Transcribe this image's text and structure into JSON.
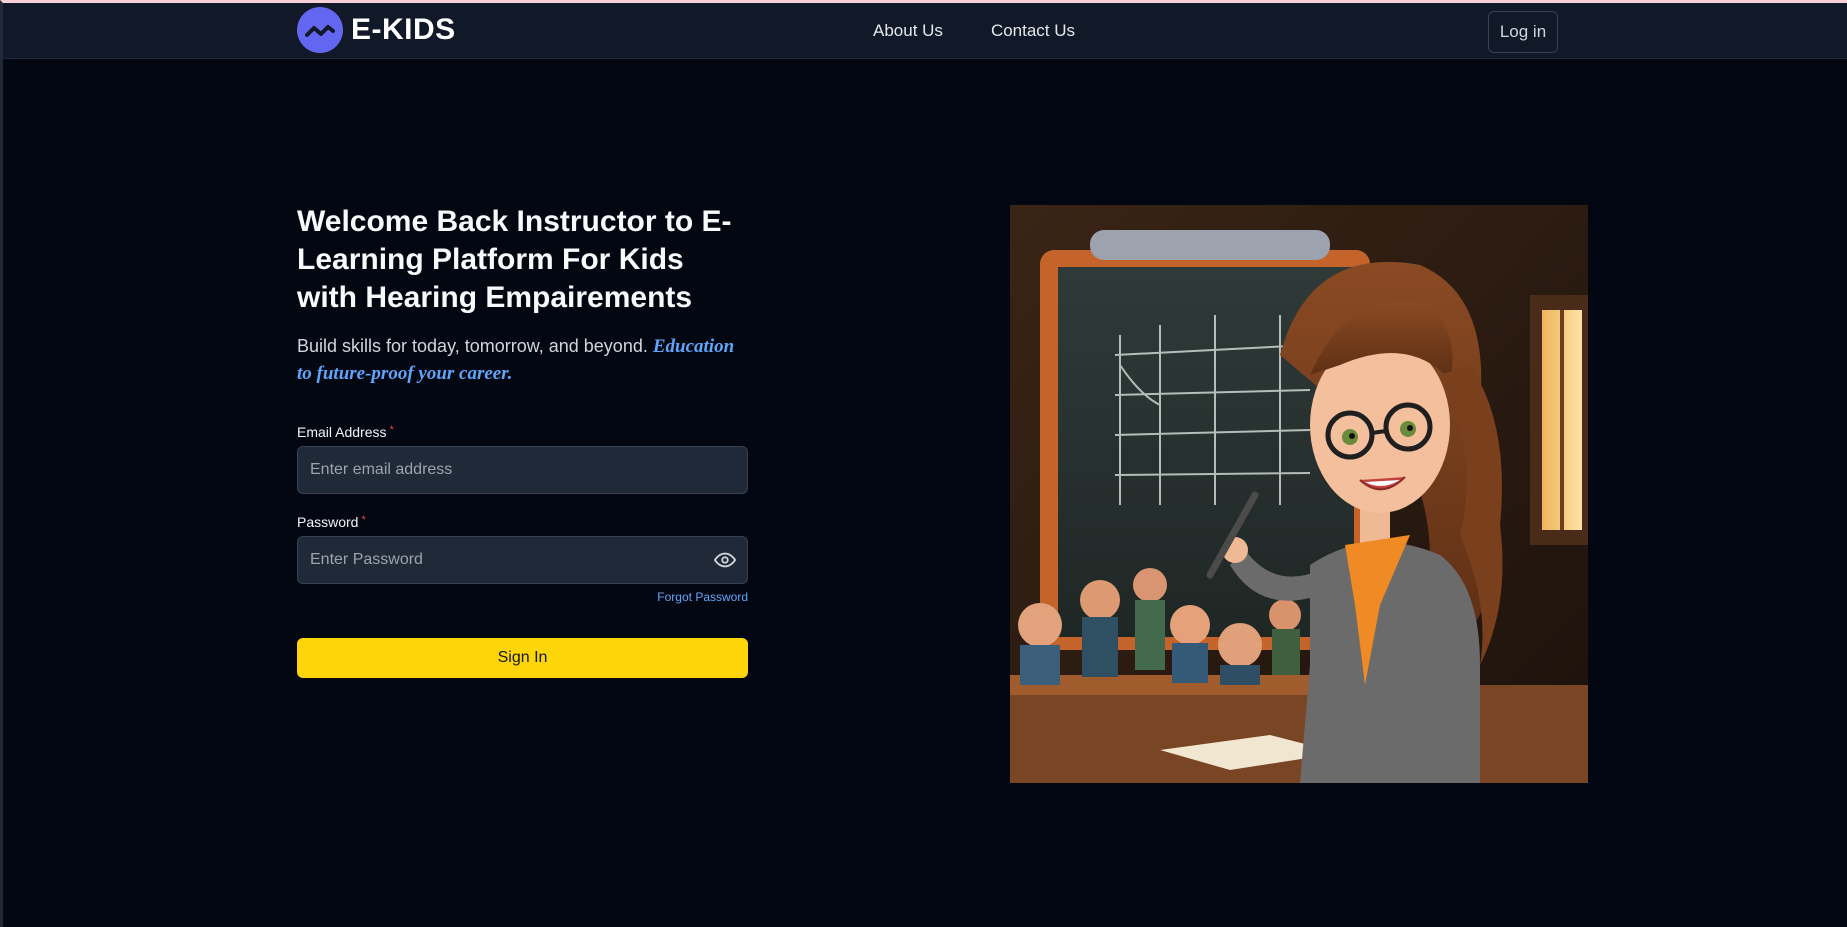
{
  "brand": {
    "name": "E-KIDS",
    "logo_icon": "wave-logo-icon",
    "accent": "#6366f1"
  },
  "nav": {
    "links": [
      {
        "label": "About Us"
      },
      {
        "label": "Contact Us"
      }
    ],
    "login_label": "Log in"
  },
  "main": {
    "heading": "Welcome Back Instructor to E-Learning Platform For Kids with Hearing Empairements",
    "subtitle_plain": "Build skills for today, tomorrow, and beyond.",
    "subtitle_emphasis": "Education to future-proof your career.",
    "email": {
      "label": "Email Address",
      "required_mark": "*",
      "placeholder": "Enter email address",
      "value": ""
    },
    "password": {
      "label": "Password",
      "required_mark": "*",
      "placeholder": "Enter Password",
      "value": "",
      "toggle_icon": "eye-icon"
    },
    "forgot_label": "Forgot Password",
    "signin_label": "Sign In",
    "signin_color": "#fdd508"
  },
  "hero": {
    "image_subject": "cartoon teacher with pointer at chalkboard in classroom"
  }
}
